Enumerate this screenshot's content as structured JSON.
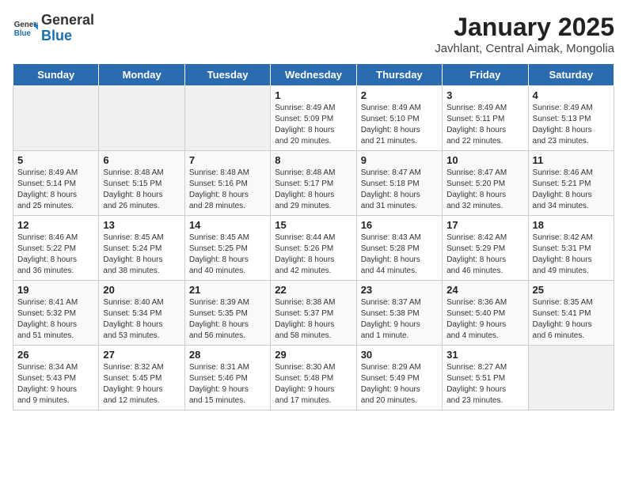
{
  "header": {
    "logo_general": "General",
    "logo_blue": "Blue",
    "title": "January 2025",
    "subtitle": "Javhlant, Central Aimak, Mongolia"
  },
  "weekdays": [
    "Sunday",
    "Monday",
    "Tuesday",
    "Wednesday",
    "Thursday",
    "Friday",
    "Saturday"
  ],
  "weeks": [
    [
      {
        "day": "",
        "info": ""
      },
      {
        "day": "",
        "info": ""
      },
      {
        "day": "",
        "info": ""
      },
      {
        "day": "1",
        "info": "Sunrise: 8:49 AM\nSunset: 5:09 PM\nDaylight: 8 hours\nand 20 minutes."
      },
      {
        "day": "2",
        "info": "Sunrise: 8:49 AM\nSunset: 5:10 PM\nDaylight: 8 hours\nand 21 minutes."
      },
      {
        "day": "3",
        "info": "Sunrise: 8:49 AM\nSunset: 5:11 PM\nDaylight: 8 hours\nand 22 minutes."
      },
      {
        "day": "4",
        "info": "Sunrise: 8:49 AM\nSunset: 5:13 PM\nDaylight: 8 hours\nand 23 minutes."
      }
    ],
    [
      {
        "day": "5",
        "info": "Sunrise: 8:49 AM\nSunset: 5:14 PM\nDaylight: 8 hours\nand 25 minutes."
      },
      {
        "day": "6",
        "info": "Sunrise: 8:48 AM\nSunset: 5:15 PM\nDaylight: 8 hours\nand 26 minutes."
      },
      {
        "day": "7",
        "info": "Sunrise: 8:48 AM\nSunset: 5:16 PM\nDaylight: 8 hours\nand 28 minutes."
      },
      {
        "day": "8",
        "info": "Sunrise: 8:48 AM\nSunset: 5:17 PM\nDaylight: 8 hours\nand 29 minutes."
      },
      {
        "day": "9",
        "info": "Sunrise: 8:47 AM\nSunset: 5:18 PM\nDaylight: 8 hours\nand 31 minutes."
      },
      {
        "day": "10",
        "info": "Sunrise: 8:47 AM\nSunset: 5:20 PM\nDaylight: 8 hours\nand 32 minutes."
      },
      {
        "day": "11",
        "info": "Sunrise: 8:46 AM\nSunset: 5:21 PM\nDaylight: 8 hours\nand 34 minutes."
      }
    ],
    [
      {
        "day": "12",
        "info": "Sunrise: 8:46 AM\nSunset: 5:22 PM\nDaylight: 8 hours\nand 36 minutes."
      },
      {
        "day": "13",
        "info": "Sunrise: 8:45 AM\nSunset: 5:24 PM\nDaylight: 8 hours\nand 38 minutes."
      },
      {
        "day": "14",
        "info": "Sunrise: 8:45 AM\nSunset: 5:25 PM\nDaylight: 8 hours\nand 40 minutes."
      },
      {
        "day": "15",
        "info": "Sunrise: 8:44 AM\nSunset: 5:26 PM\nDaylight: 8 hours\nand 42 minutes."
      },
      {
        "day": "16",
        "info": "Sunrise: 8:43 AM\nSunset: 5:28 PM\nDaylight: 8 hours\nand 44 minutes."
      },
      {
        "day": "17",
        "info": "Sunrise: 8:42 AM\nSunset: 5:29 PM\nDaylight: 8 hours\nand 46 minutes."
      },
      {
        "day": "18",
        "info": "Sunrise: 8:42 AM\nSunset: 5:31 PM\nDaylight: 8 hours\nand 49 minutes."
      }
    ],
    [
      {
        "day": "19",
        "info": "Sunrise: 8:41 AM\nSunset: 5:32 PM\nDaylight: 8 hours\nand 51 minutes."
      },
      {
        "day": "20",
        "info": "Sunrise: 8:40 AM\nSunset: 5:34 PM\nDaylight: 8 hours\nand 53 minutes."
      },
      {
        "day": "21",
        "info": "Sunrise: 8:39 AM\nSunset: 5:35 PM\nDaylight: 8 hours\nand 56 minutes."
      },
      {
        "day": "22",
        "info": "Sunrise: 8:38 AM\nSunset: 5:37 PM\nDaylight: 8 hours\nand 58 minutes."
      },
      {
        "day": "23",
        "info": "Sunrise: 8:37 AM\nSunset: 5:38 PM\nDaylight: 9 hours\nand 1 minute."
      },
      {
        "day": "24",
        "info": "Sunrise: 8:36 AM\nSunset: 5:40 PM\nDaylight: 9 hours\nand 4 minutes."
      },
      {
        "day": "25",
        "info": "Sunrise: 8:35 AM\nSunset: 5:41 PM\nDaylight: 9 hours\nand 6 minutes."
      }
    ],
    [
      {
        "day": "26",
        "info": "Sunrise: 8:34 AM\nSunset: 5:43 PM\nDaylight: 9 hours\nand 9 minutes."
      },
      {
        "day": "27",
        "info": "Sunrise: 8:32 AM\nSunset: 5:45 PM\nDaylight: 9 hours\nand 12 minutes."
      },
      {
        "day": "28",
        "info": "Sunrise: 8:31 AM\nSunset: 5:46 PM\nDaylight: 9 hours\nand 15 minutes."
      },
      {
        "day": "29",
        "info": "Sunrise: 8:30 AM\nSunset: 5:48 PM\nDaylight: 9 hours\nand 17 minutes."
      },
      {
        "day": "30",
        "info": "Sunrise: 8:29 AM\nSunset: 5:49 PM\nDaylight: 9 hours\nand 20 minutes."
      },
      {
        "day": "31",
        "info": "Sunrise: 8:27 AM\nSunset: 5:51 PM\nDaylight: 9 hours\nand 23 minutes."
      },
      {
        "day": "",
        "info": ""
      }
    ]
  ]
}
